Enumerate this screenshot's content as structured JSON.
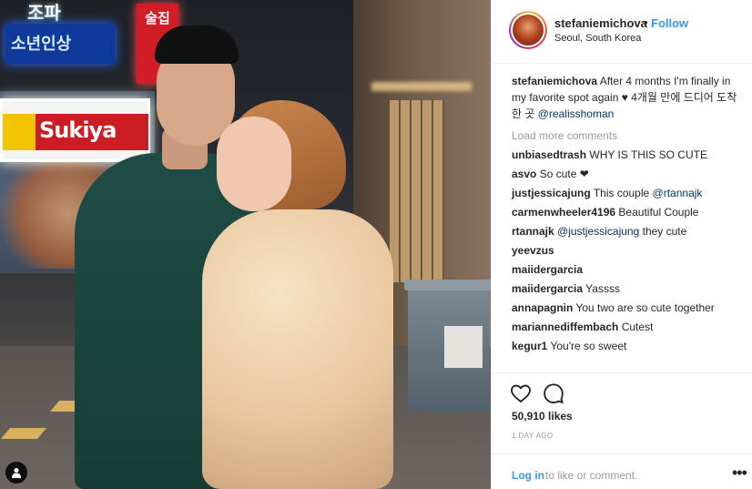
{
  "photo": {
    "signs": {
      "top": "조파",
      "blue": "소년인상",
      "red": "술집",
      "sukiya": "Sukiya"
    }
  },
  "header": {
    "username": "stefaniemichova",
    "separator": "•",
    "follow_label": "Follow",
    "location": "Seoul, South Korea"
  },
  "caption": {
    "username": "stefaniemichova",
    "text": "After 4 months I'm finally in my favorite spot again ♥",
    "korean": "4개월 만에 드디어 도착한 곳",
    "mention": "@realisshoman"
  },
  "load_more": "Load more comments",
  "comments": [
    {
      "user": "unbiasedtrash",
      "text": "WHY IS THIS SO CUTE",
      "mention": ""
    },
    {
      "user": "asvo",
      "text": "So cute ❤",
      "mention": ""
    },
    {
      "user": "justjessicajung",
      "text": "This couple ",
      "mention": "@rtannajk"
    },
    {
      "user": "carmenwheeler4196",
      "text": "Beautiful Couple",
      "mention": ""
    },
    {
      "user": "rtannajk",
      "text": "they cute",
      "mention": "@justjessicajung"
    },
    {
      "user": "yeevzus",
      "text": "",
      "mention": ""
    },
    {
      "user": "maiidergarcia",
      "text": "",
      "mention": ""
    },
    {
      "user": "maiidergarcia",
      "text": "Yassss",
      "mention": ""
    },
    {
      "user": "annapagnin",
      "text": "You two are so cute together",
      "mention": ""
    },
    {
      "user": "mariannediffembach",
      "text": "Cutest",
      "mention": ""
    },
    {
      "user": "kegur1",
      "text": "You're so sweet",
      "mention": ""
    }
  ],
  "actions": {
    "icons": [
      "heart-icon",
      "comment-icon"
    ],
    "likes": "50,910 likes",
    "time": "1 DAY AGO"
  },
  "login": {
    "link": "Log in",
    "rest": "to like or comment.",
    "more": "•••"
  },
  "colors": {
    "link_blue": "#3897f0",
    "mention_blue": "#003569",
    "text": "#262626",
    "muted": "#999999",
    "border": "#efefef"
  }
}
